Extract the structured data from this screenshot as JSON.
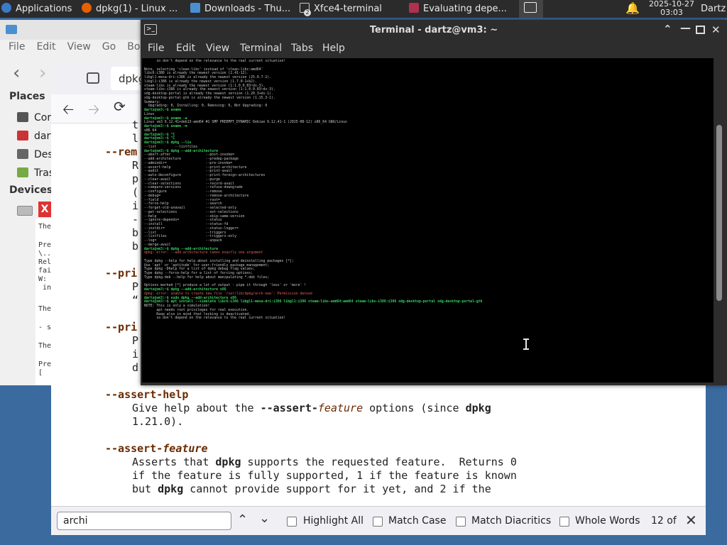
{
  "panel": {
    "applications": "Applications",
    "tasks": [
      "dpkg(1) - Linux ...",
      "Downloads - Thu...",
      "Xfce4-terminal",
      "Evaluating depe..."
    ],
    "terminal_badge": "2",
    "date": "2025-10-27",
    "time": "03:03",
    "user": "Dartz"
  },
  "filemanager": {
    "menu": [
      "File",
      "Edit",
      "View",
      "Go",
      "Boo"
    ],
    "places_header": "Places",
    "places": [
      "Cor",
      "dart",
      "Des",
      "Tras"
    ],
    "devices_header": "Devices",
    "snippets": [
      "The",
      "Pre",
      "\\..",
      "Rel",
      "fai",
      "W:",
      " in",
      "The",
      "- s",
      "The",
      "Pre",
      "["
    ]
  },
  "browser": {
    "tab_label": "dpkg",
    "man_lines": [
      {
        "type": "text",
        "indent": 2,
        "text": "t"
      },
      {
        "type": "text",
        "indent": 2,
        "text": "l"
      },
      {
        "type": "opt",
        "indent": 1,
        "text": "--rem"
      },
      {
        "type": "text",
        "indent": 2,
        "text": "R"
      },
      {
        "type": "text",
        "indent": 2,
        "text": "p"
      },
      {
        "type": "text",
        "indent": 2,
        "text": "("
      },
      {
        "type": "text",
        "indent": 2,
        "text": "i"
      },
      {
        "type": "text",
        "indent": 2,
        "text": "-"
      },
      {
        "type": "text",
        "indent": 2,
        "text": "b"
      },
      {
        "type": "text",
        "indent": 2,
        "text": "b"
      },
      {
        "type": "blank"
      },
      {
        "type": "opt",
        "indent": 1,
        "text": "--pri"
      },
      {
        "type": "text",
        "indent": 2,
        "text": "P"
      },
      {
        "type": "text",
        "indent": 2,
        "text": "“"
      },
      {
        "type": "blank"
      },
      {
        "type": "opt",
        "indent": 1,
        "text": "--pri"
      },
      {
        "type": "text",
        "indent": 2,
        "text": "P"
      },
      {
        "type": "text",
        "indent": 2,
        "text": "i"
      },
      {
        "type": "text",
        "indent": 2,
        "text": "d"
      },
      {
        "type": "blank"
      },
      {
        "type": "opt",
        "indent": 1,
        "text": "--assert-help"
      },
      {
        "type": "text",
        "indent": 2,
        "text": "Give help about the --assert-feature options (since dpkg"
      },
      {
        "type": "text",
        "indent": 2,
        "text": "1.21.0)."
      },
      {
        "type": "blank"
      },
      {
        "type": "opt",
        "indent": 1,
        "text": "--assert-feature"
      },
      {
        "type": "text",
        "indent": 2,
        "text": "Asserts that dpkg supports the requested feature.  Returns 0"
      },
      {
        "type": "text",
        "indent": 2,
        "text": "if the feature is fully supported, 1 if the feature is known"
      },
      {
        "type": "text",
        "indent": 2,
        "text": "but dpkg cannot provide support for it yet, and 2 if the"
      }
    ],
    "find": {
      "query": "archi",
      "highlight_all": "Highlight All",
      "match_case": "Match Case",
      "match_diacritics": "Match Diacritics",
      "whole_words": "Whole Words",
      "count": "12 of"
    }
  },
  "terminal": {
    "title": "Terminal - dartz@vm3: ~",
    "menu": [
      "File",
      "Edit",
      "View",
      "Terminal",
      "Tabs",
      "Help"
    ],
    "lines": [
      {
        "c": "t",
        "t": "      so don't depend on the relevance to the real current situation!"
      },
      {
        "c": "t",
        "t": ""
      },
      {
        "c": "t",
        "t": "Note, selecting 'clean-libc' instead of 'clean-libc:amd64'"
      },
      {
        "c": "t",
        "t": "libc6:i386 is already the newest version (2.41-12)."
      },
      {
        "c": "t",
        "t": "libgl1-mesa-dri:i386 is already the newest version (25.0.7-2)."
      },
      {
        "c": "t",
        "t": "libgl1:i386 is already the newest version (1.7.0-1+b2)."
      },
      {
        "c": "t",
        "t": "steam-libs is already the newest version (1:1.0.0.83~ds-3)."
      },
      {
        "c": "t",
        "t": "steam-libs-i386 is already the newest version (1:1.0.0.83~ds-3)."
      },
      {
        "c": "t",
        "t": "xdg-desktop-portal is already the newest version (1.20.3+ds-1)."
      },
      {
        "c": "t",
        "t": "xdg-desktop-portal-gtk is already the newest version (1.15.3-1)."
      },
      {
        "c": "t",
        "t": "Summary:"
      },
      {
        "c": "t",
        "t": "  Upgrading: 0, Installing: 0, Removing: 0, Not Upgrading: 0"
      },
      {
        "c": "p",
        "t": "dartz@vm3:~$ uname"
      },
      {
        "c": "t",
        "t": "Linux"
      },
      {
        "c": "p",
        "t": "dartz@vm3:~$ uname -a"
      },
      {
        "c": "t",
        "t": "Linux vm3 6.12.41+deb13-amd64 #1 SMP PREEMPT_DYNAMIC Debian 6.12.41-1 (2025-08-12) x86_64 GNU/Linux"
      },
      {
        "c": "p",
        "t": "dartz@vm3:~$ uname -m"
      },
      {
        "c": "t",
        "t": "x86_64"
      },
      {
        "c": "p",
        "t": "dartz@vm3:~$ ^C"
      },
      {
        "c": "p",
        "t": "dartz@vm3:~$ ^C"
      },
      {
        "c": "p",
        "t": "dartz@vm3:~$ dpkg --lis"
      },
      {
        "c": "t",
        "t": "--list         --listfiles"
      },
      {
        "c": "p",
        "t": "dartz@vm3:~$ dpkg --add-architecture"
      },
      {
        "c": "t",
        "t": "--abort-after                 --post-invoke="
      },
      {
        "c": "t",
        "t": "--add-architecture            --predep-package"
      },
      {
        "c": "t",
        "t": "--admindir=                   --pre-invoke="
      },
      {
        "c": "t",
        "t": "--assert-help                 --print-architecture"
      },
      {
        "c": "t",
        "t": "--audit                       --print-avail"
      },
      {
        "c": "t",
        "t": "--auto-deconfigure            --print-foreign-architectures"
      },
      {
        "c": "t",
        "t": "--clear-avail                 --purge"
      },
      {
        "c": "t",
        "t": "--clear-selections            --record-avail"
      },
      {
        "c": "t",
        "t": "--compare-versions            --refuse-downgrade"
      },
      {
        "c": "t",
        "t": "--configure                   --remove"
      },
      {
        "c": "t",
        "t": "--debug=                      --remove-architecture"
      },
      {
        "c": "t",
        "t": "--field                       --root="
      },
      {
        "c": "t",
        "t": "--force-help                  --search"
      },
      {
        "c": "t",
        "t": "--forget-old-unavail          --selected-only"
      },
      {
        "c": "t",
        "t": "--get-selections              --set-selections"
      },
      {
        "c": "t",
        "t": "--help                        --skip-same-version"
      },
      {
        "c": "t",
        "t": "--ignore-depends=             --status"
      },
      {
        "c": "t",
        "t": "--install                     --status-fd"
      },
      {
        "c": "t",
        "t": "--instdir=                    --status-logger="
      },
      {
        "c": "t",
        "t": "--list                        --triggers"
      },
      {
        "c": "t",
        "t": "--listfiles                   --triggers-only"
      },
      {
        "c": "t",
        "t": "--log=                        --unpack"
      },
      {
        "c": "t",
        "t": "--merge-avail"
      },
      {
        "c": "p",
        "t": "dartz@vm3:~$ dpkg --add-architecture"
      },
      {
        "c": "e",
        "t": "dpkg: error: --add-architecture takes exactly one argument"
      },
      {
        "c": "t",
        "t": ""
      },
      {
        "c": "t",
        "t": "Type dpkg --help for help about installing and deinstalling packages [*];"
      },
      {
        "c": "t",
        "t": "Use 'apt' or 'aptitude' for user-friendly package management;"
      },
      {
        "c": "t",
        "t": "Type dpkg -Dhelp for a list of dpkg debug flag values;"
      },
      {
        "c": "t",
        "t": "Type dpkg --force-help for a list of forcing options;"
      },
      {
        "c": "t",
        "t": "Type dpkg-deb --help for help about manipulating *.deb files;"
      },
      {
        "c": "t",
        "t": ""
      },
      {
        "c": "t",
        "t": "Options marked [*] produce a lot of output - pipe it through 'less' or 'more' !"
      },
      {
        "c": "p",
        "t": "dartz@vm3:~$ dpkg --add-architecture x86"
      },
      {
        "c": "e",
        "t": "dpkg: error: unable to create new file '/var/lib/dpkg/arch-new': Permission denied"
      },
      {
        "c": "p",
        "t": "dartz@vm3:~$ sudo dpkg --add-architecture x86"
      },
      {
        "c": "p",
        "t": "dartz@vm3:~$ apt install --simulate libc6:i386 libgl1-mesa-dri:i386 libgl1:i386 steam-libs-amd64:amd64 steam-libs-i386:i386 xdg-desktop-portal xdg-desktop-portal-gtk"
      },
      {
        "c": "t",
        "t": "NOTE: This is only a simulation!"
      },
      {
        "c": "t",
        "t": "      apt needs root privileges for real execution."
      },
      {
        "c": "t",
        "t": "      Keep also in mind that locking is deactivated,"
      },
      {
        "c": "t",
        "t": "      so don't depend on the relevance to the real current situation!"
      }
    ]
  }
}
